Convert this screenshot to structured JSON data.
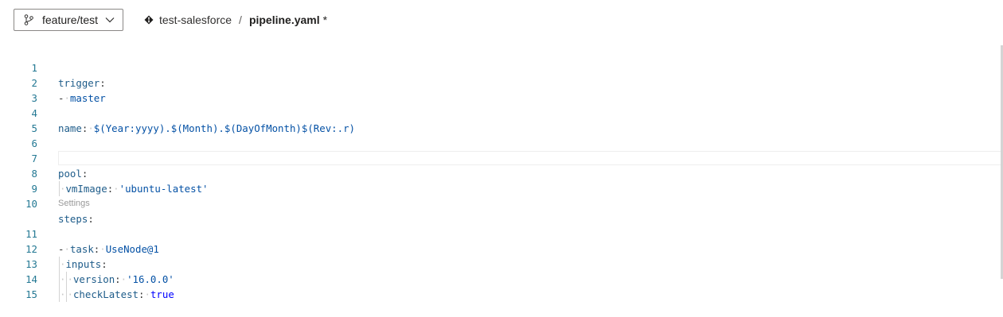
{
  "header": {
    "branch": "feature/test",
    "repo": "test-salesforce",
    "separator": "/",
    "file": "pipeline.yaml",
    "dirty_marker": "*"
  },
  "editor": {
    "codelens": "Settings",
    "line_numbers": [
      "1",
      "2",
      "3",
      "4",
      "5",
      "6",
      "7",
      "8",
      "9",
      "10",
      "11",
      "12",
      "13",
      "14",
      "15"
    ],
    "lines": {
      "l1_key": "trigger",
      "l2_dash": "-",
      "l2_value": "master",
      "l4_key": "name",
      "l4_value": "$(Year:yyyy).$(Month).$(DayOfMonth)$(Rev:.r)",
      "l7_key": "pool",
      "l8_key": "vmImage",
      "l8_value": "'ubuntu-latest'",
      "l10_key": "steps",
      "l11_dash": "-",
      "l11_key": "task",
      "l11_value": "UseNode@1",
      "l12_key": "inputs",
      "l13_key": "version",
      "l13_value": "'16.0.0'",
      "l14_key": "checkLatest",
      "l14_value": "true"
    }
  },
  "colors": {
    "line_number": "#237893",
    "key": "#1e5c8a",
    "string": "#0451a5",
    "boolean": "#0000ff"
  },
  "icons": [
    "branch-icon",
    "chevron-down-icon",
    "repo-icon"
  ]
}
